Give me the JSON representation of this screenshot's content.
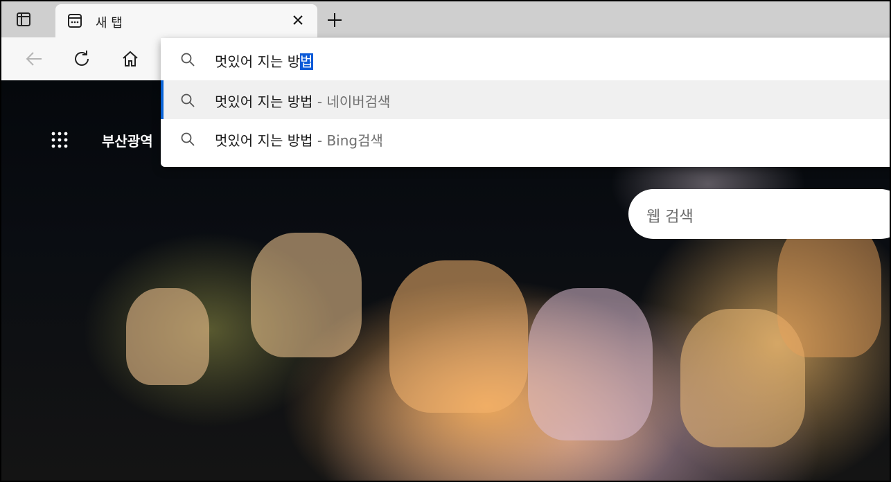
{
  "browser": {
    "tab": {
      "title": "새 탭"
    }
  },
  "omnibox": {
    "query_prefix": "멋있어 지는 방",
    "query_selected": "법",
    "suggestions": [
      {
        "text": "멋있어 지는 방법",
        "source": " - 네이버검색"
      },
      {
        "text": "멋있어 지는 방법",
        "source": " - Bing검색"
      }
    ]
  },
  "page": {
    "location": "부산광역",
    "search_placeholder": "웹 검색"
  },
  "colors": {
    "accent": "#0a63d6",
    "tabstrip": "#cfcfcf",
    "toolbar": "#f7f7f7"
  },
  "icons": [
    "tab-actions-icon",
    "new-tab-page-icon",
    "close-icon",
    "plus-icon",
    "back-arrow-icon",
    "refresh-icon",
    "home-icon",
    "search-icon",
    "apps-grid-icon"
  ]
}
